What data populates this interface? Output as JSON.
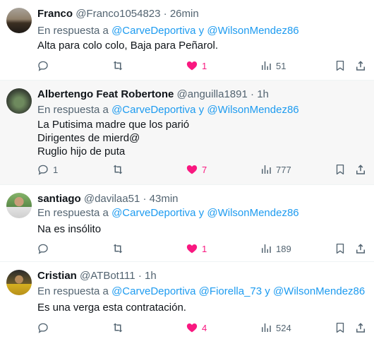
{
  "tweets": [
    {
      "name": "Franco",
      "handle": "@Franco1054823",
      "time": "26min",
      "reply_prefix": "En respuesta a",
      "reply_mentions": "@CarveDeportiva y @WilsonMendez86",
      "lines": [
        "Alta para colo colo, Baja para Peñarol."
      ],
      "replies": "",
      "retweets": "",
      "likes": "1",
      "views": "51"
    },
    {
      "name": "Albertengo Feat Robertone",
      "handle": "@anguilla1891",
      "time": "1h",
      "reply_prefix": "En respuesta a",
      "reply_mentions": "@CarveDeportiva y @WilsonMendez86",
      "lines": [
        "La Putisima madre que los parió",
        "Dirigentes de mierd@",
        "Ruglio hijo de puta"
      ],
      "replies": "1",
      "retweets": "",
      "likes": "7",
      "views": "777"
    },
    {
      "name": "santiago",
      "handle": "@davilaa51",
      "time": "43min",
      "reply_prefix": "En respuesta a",
      "reply_mentions": "@CarveDeportiva y @WilsonMendez86",
      "lines": [
        "Na es insólito"
      ],
      "replies": "",
      "retweets": "",
      "likes": "1",
      "views": "189"
    },
    {
      "name": "Cristian",
      "handle": "@ATBot111",
      "time": "1h",
      "reply_prefix": "En respuesta a",
      "reply_mentions": "@CarveDeportiva @Fiorella_73 y @WilsonMendez86",
      "lines": [
        "Es una verga esta contratación."
      ],
      "replies": "",
      "retweets": "",
      "likes": "4",
      "views": "524"
    }
  ],
  "separator": "·",
  "colors": {
    "accent": "#1d9bf0",
    "like": "#f91880",
    "muted": "#536471",
    "highlight_bg": "#f7f7f7"
  },
  "icons": [
    "reply-icon",
    "retweet-icon",
    "heart-icon",
    "views-icon",
    "bookmark-icon",
    "share-icon"
  ]
}
